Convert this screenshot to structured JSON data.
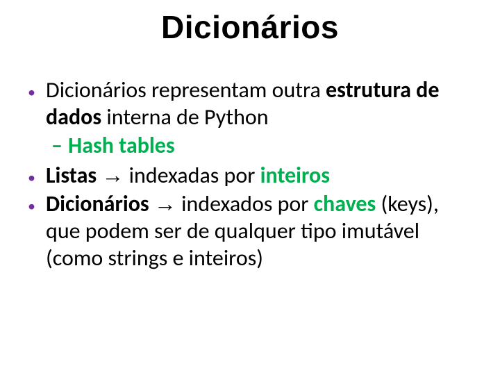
{
  "title": "Dicionários",
  "b1": {
    "p1": "Dicionários representam outra ",
    "p2_bold": "estrutura de dados",
    "p3": " interna de Python"
  },
  "sub1": {
    "dash": "–",
    "text": "Hash tables"
  },
  "b2": {
    "p1_bold": "Listas",
    "p2": " ",
    "arrow": "→",
    "p3": " indexadas por ",
    "p4_bold_green": "inteiros"
  },
  "b3": {
    "p1_bold": "Dicionários",
    "p2": " ",
    "arrow": "→",
    "p3": " indexados por ",
    "p4_bold_green": "chaves",
    "p5": " (keys), que podem ser de qualquer tipo imutável (como strings e inteiros)"
  },
  "bullet_glyph": "•"
}
